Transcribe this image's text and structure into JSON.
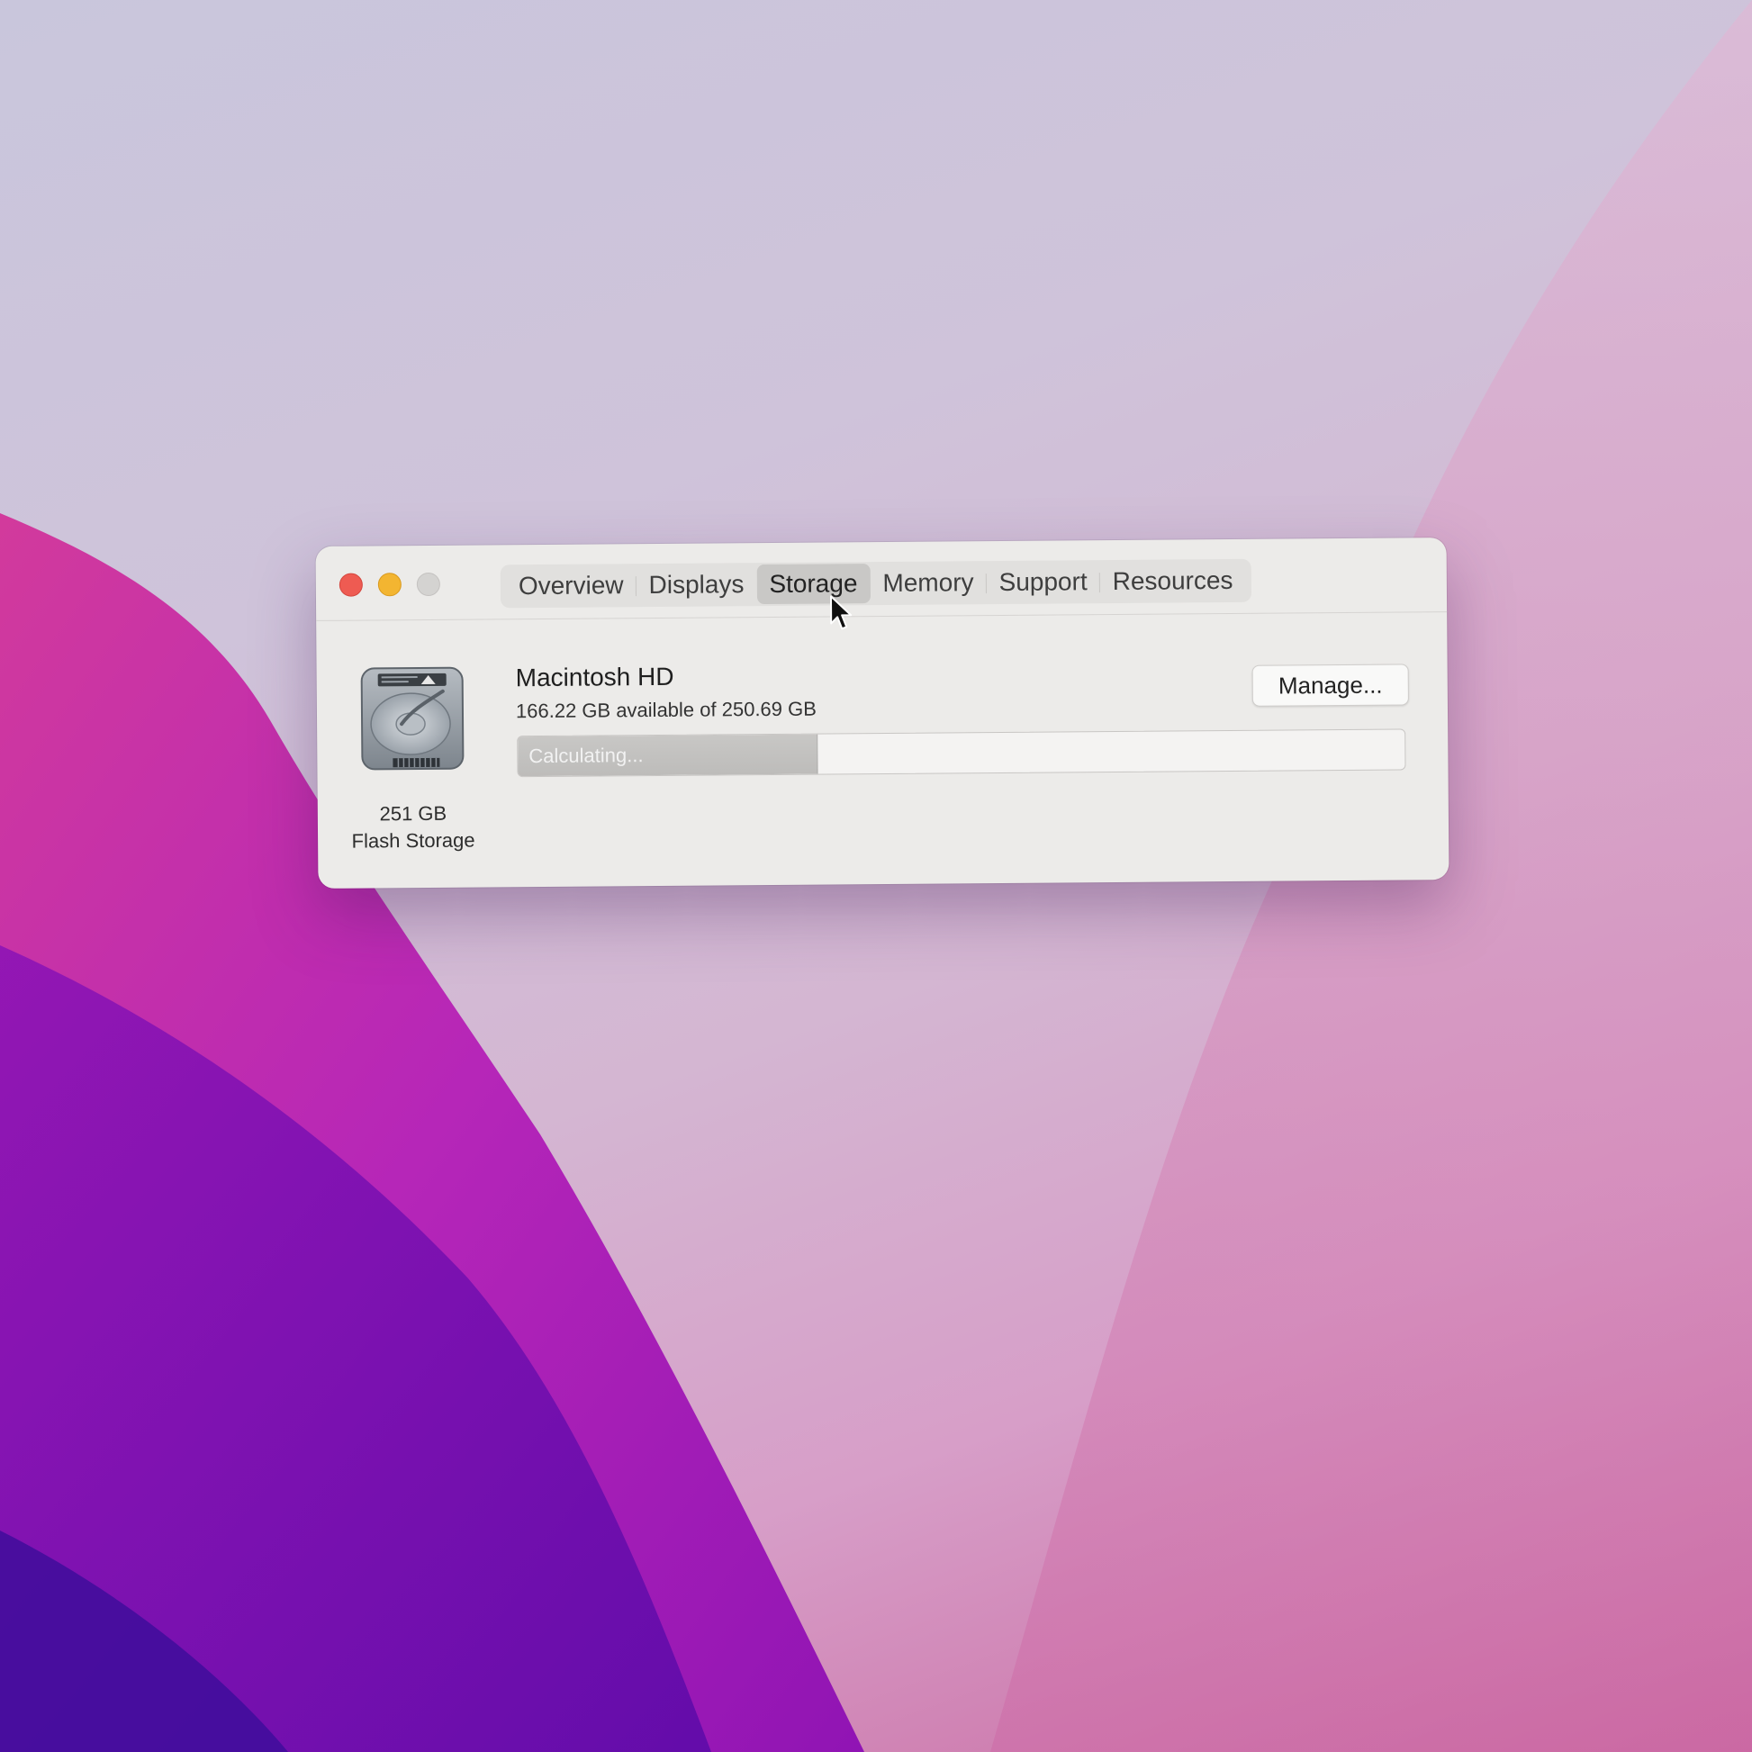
{
  "window": {
    "tabs": [
      {
        "label": "Overview",
        "active": false
      },
      {
        "label": "Displays",
        "active": false
      },
      {
        "label": "Storage",
        "active": true
      },
      {
        "label": "Memory",
        "active": false
      },
      {
        "label": "Support",
        "active": false
      },
      {
        "label": "Resources",
        "active": false
      }
    ]
  },
  "storage": {
    "disk": {
      "icon": "hard-disk-icon",
      "capacity": "251 GB",
      "type": "Flash Storage"
    },
    "volume": {
      "name": "Macintosh HD",
      "available": "166.22 GB available of 250.69 GB"
    },
    "usage_bar": {
      "label": "Calculating...",
      "fill_fraction": 0.337
    },
    "manage_label": "Manage..."
  },
  "colors": {
    "close": "#ee5b52",
    "minimize": "#f3b531",
    "zoom_disabled": "#d4d3d1",
    "wallpaper_magenta": "#b02ab5",
    "wallpaper_violet": "#6a10b8"
  }
}
